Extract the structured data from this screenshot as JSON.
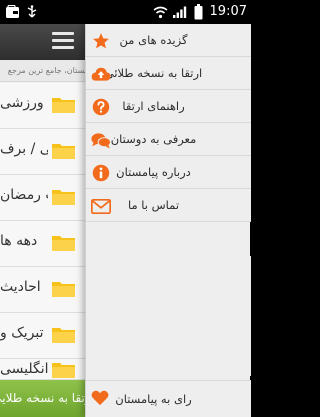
{
  "status_bar": {
    "time": "19:07"
  },
  "background_app": {
    "subtitle": "پیامستان، جامع ترین مرجع",
    "rows": [
      {
        "label": "ورزشی"
      },
      {
        "label": "برفی / برف"
      },
      {
        "label": "اوقات رمضان"
      },
      {
        "label": "دهه ها"
      },
      {
        "label": "احادیث"
      },
      {
        "label": "تبریک و"
      },
      {
        "label": "انگلیسی"
      }
    ],
    "upgrade_button": "ارتقا به نسخه طلایی"
  },
  "drawer": {
    "items": [
      {
        "label": "گزیده های من",
        "icon": "star-icon"
      },
      {
        "label": "ارتقا به نسخه طلائی",
        "icon": "cloud-upload-icon"
      },
      {
        "label": "راهنمای ارتقا",
        "icon": "help-icon"
      },
      {
        "label": "معرفی به دوستان",
        "icon": "chat-icon"
      },
      {
        "label": "درباره پیامستان",
        "icon": "info-icon"
      },
      {
        "label": "تماس با ما",
        "icon": "mail-icon"
      }
    ],
    "bottom": {
      "label": "رای به پیامستان",
      "icon": "heart-icon"
    }
  },
  "colors": {
    "accent": "#f26a1b",
    "folder": "#f7c21c",
    "green": "#7ab33a"
  }
}
